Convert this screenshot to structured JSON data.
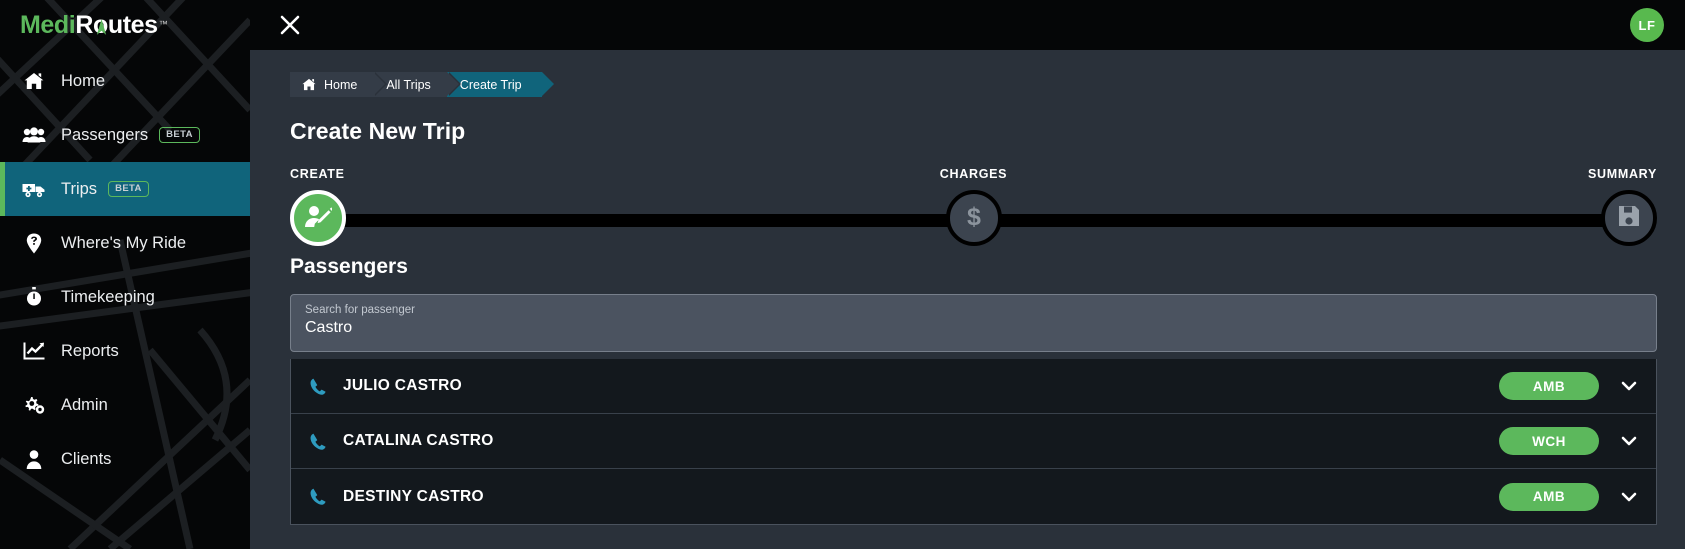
{
  "brand": {
    "name_part1": "Medi",
    "name_part2": "Routes",
    "trademark": "™",
    "green": "#5cb85c",
    "compass_icon": "compass-arrow-icon"
  },
  "topbar": {
    "close_icon": "close-icon",
    "avatar_initials": "LF",
    "avatar_color": "#58b94e"
  },
  "sidebar": {
    "active_index": 2,
    "highlight_color": "#10647b",
    "items": [
      {
        "label": "Home",
        "icon": "home-icon",
        "badge": ""
      },
      {
        "label": "Passengers",
        "icon": "passengers-icon",
        "badge": "BETA"
      },
      {
        "label": "Trips",
        "icon": "ambulance-icon",
        "badge": "BETA"
      },
      {
        "label": "Where's My Ride",
        "icon": "map-pin-question-icon",
        "badge": ""
      },
      {
        "label": "Timekeeping",
        "icon": "stopwatch-icon",
        "badge": ""
      },
      {
        "label": "Reports",
        "icon": "chart-line-icon",
        "badge": ""
      },
      {
        "label": "Admin",
        "icon": "gears-icon",
        "badge": ""
      },
      {
        "label": "Clients",
        "icon": "user-icon",
        "badge": ""
      }
    ]
  },
  "breadcrumb": {
    "home_icon": "home-icon",
    "items": [
      {
        "label": "Home",
        "active": false
      },
      {
        "label": "All Trips",
        "active": false
      },
      {
        "label": "Create Trip",
        "active": true
      }
    ]
  },
  "page": {
    "title": "Create New Trip"
  },
  "stepper": {
    "steps": [
      {
        "label": "CREATE",
        "icon": "user-edit-icon",
        "state": "done"
      },
      {
        "label": "CHARGES",
        "icon": "dollar-sign-icon",
        "state": "pending"
      },
      {
        "label": "SUMMARY",
        "icon": "floppy-save-icon",
        "state": "pending"
      }
    ],
    "track_color": "#000000",
    "done_color": "#5cb85c"
  },
  "passengers": {
    "section_title": "Passengers",
    "search": {
      "label": "Search for passenger",
      "value": "Castro",
      "placeholder": "Search for passenger"
    },
    "results": [
      {
        "name": "JULIO CASTRO",
        "type": "AMB",
        "phone_icon": "phone-icon",
        "chevron_icon": "chevron-down-icon"
      },
      {
        "name": "CATALINA CASTRO",
        "type": "WCH",
        "phone_icon": "phone-icon",
        "chevron_icon": "chevron-down-icon"
      },
      {
        "name": "DESTINY CASTRO",
        "type": "AMB",
        "phone_icon": "phone-icon",
        "chevron_icon": "chevron-down-icon"
      }
    ]
  }
}
